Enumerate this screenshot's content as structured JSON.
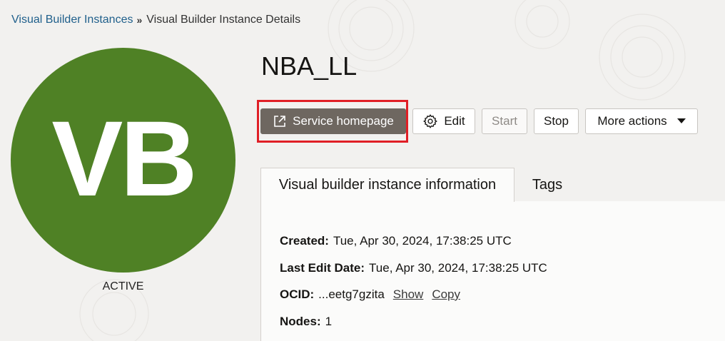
{
  "breadcrumb": {
    "parent": "Visual Builder Instances",
    "separator": "»",
    "current": "Visual Builder Instance Details"
  },
  "avatar": {
    "initials": "VB",
    "color": "#4f8125"
  },
  "status": "ACTIVE",
  "title": "NBA_LL",
  "actions": {
    "service_homepage": "Service homepage",
    "edit": "Edit",
    "start": "Start",
    "stop": "Stop",
    "more_actions": "More actions"
  },
  "tabs": [
    {
      "label": "Visual builder instance information",
      "active": true
    },
    {
      "label": "Tags",
      "active": false
    }
  ],
  "info": {
    "created_label": "Created:",
    "created_value": "Tue, Apr 30, 2024, 17:38:25 UTC",
    "last_edit_label": "Last Edit Date:",
    "last_edit_value": "Tue, Apr 30, 2024, 17:38:25 UTC",
    "ocid_label": "OCID:",
    "ocid_value": "...eetg7gzita",
    "show_link": "Show",
    "copy_link": "Copy",
    "nodes_label": "Nodes:",
    "nodes_value": "1"
  },
  "colors": {
    "accent_link": "#1f5f8b",
    "highlight": "#e01f26",
    "primary_button": "#6e6760"
  }
}
